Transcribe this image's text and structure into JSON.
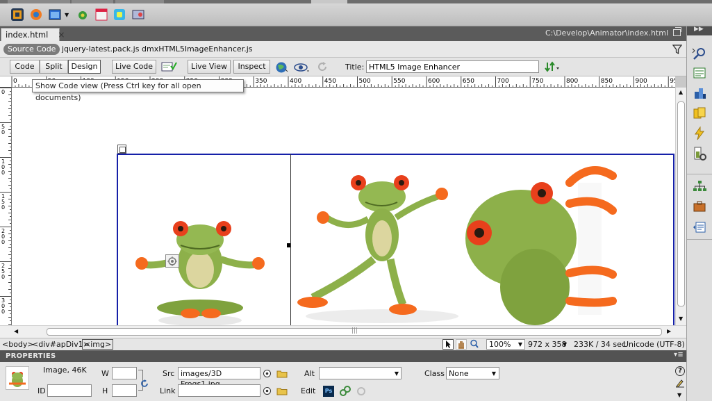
{
  "document_tab": {
    "name": "index.html",
    "close": "×",
    "path": "C:\\Develop\\Animator\\index.html"
  },
  "related_files": {
    "source": "Source Code",
    "files": [
      "jquery-latest.pack.js",
      "dmxHTML5ImageEnhancer.js"
    ]
  },
  "doc_toolbar": {
    "code": "Code",
    "split": "Split",
    "design": "Design",
    "live_code": "Live Code",
    "live_view": "Live View",
    "inspect": "Inspect",
    "title_label": "Title:",
    "title_value": "HTML5 Image Enhancer"
  },
  "tooltip": "Show Code view (Press Ctrl key for all open documents)",
  "ruler": {
    "h_labels": [
      "0",
      "50",
      "100",
      "150",
      "200",
      "250",
      "300",
      "350",
      "400",
      "450",
      "500",
      "550",
      "600",
      "650",
      "700",
      "750",
      "800",
      "850",
      "900",
      "950"
    ],
    "v_labels": [
      "0",
      "5 0",
      "1 0 0",
      "1 5 0",
      "2 0 0",
      "2 5 0",
      "3 0 0"
    ]
  },
  "status_bar": {
    "tag_body": "<body>",
    "tag_div": "<div#apDiv1>",
    "tag_img": "<img>",
    "zoom": "100%",
    "size": "972 x 358",
    "weight": "233K / 34 sec",
    "encoding": "Unicode (UTF-8)"
  },
  "properties": {
    "header": "PROPERTIES",
    "type": "Image, 46K",
    "w_label": "W",
    "h_label": "H",
    "id_label": "ID",
    "src_label": "Src",
    "src_value": "images/3D Frogs1.jpg",
    "link_label": "Link",
    "alt_label": "Alt",
    "class_label": "Class",
    "class_value": "None",
    "edit_label": "Edit",
    "ps": "Ps"
  },
  "colors": {
    "selection_border": "#1520a8",
    "frog_body": "#8db04a",
    "frog_eye": "#e8401c",
    "frog_foot": "#f56a1e"
  },
  "icons": [
    "search-icon",
    "filter-icon",
    "globe-icon",
    "eye-icon",
    "refresh-icon",
    "file-manage-icon",
    "insert-icon",
    "css-icon",
    "assets-icon",
    "snippets-icon",
    "behaviors-icon",
    "databases-icon",
    "sitemap-icon",
    "components-icon",
    "code-inspector-icon"
  ]
}
